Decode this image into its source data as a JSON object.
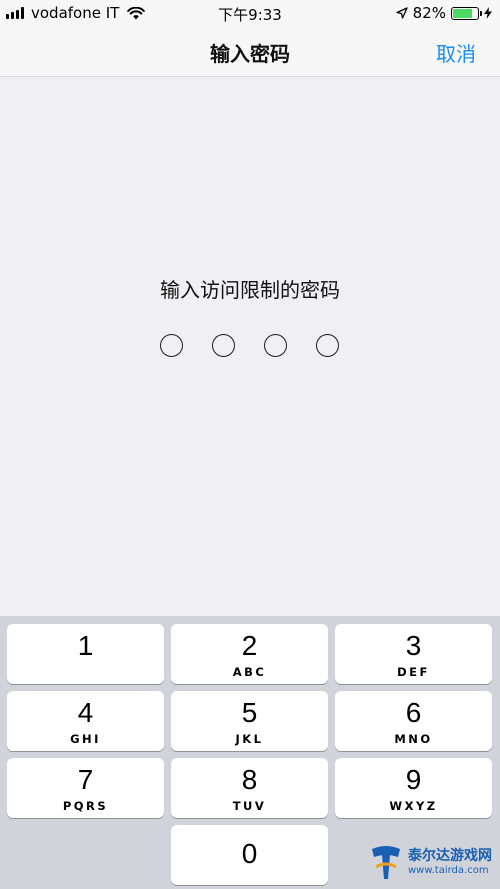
{
  "status_bar": {
    "carrier": "vodafone IT",
    "time": "下午9:33",
    "battery_percent": "82%",
    "battery_level": 0.82,
    "icons": [
      "signal-icon",
      "wifi-icon",
      "location-arrow-icon",
      "battery-icon",
      "charging-bolt-icon"
    ]
  },
  "nav": {
    "title": "输入密码",
    "cancel_label": "取消"
  },
  "prompt": "输入访问限制的密码",
  "passcode": {
    "length": 4,
    "entered": 0
  },
  "keypad": {
    "keys": [
      {
        "digit": "1",
        "letters": ""
      },
      {
        "digit": "2",
        "letters": "ABC"
      },
      {
        "digit": "3",
        "letters": "DEF"
      },
      {
        "digit": "4",
        "letters": "GHI"
      },
      {
        "digit": "5",
        "letters": "JKL"
      },
      {
        "digit": "6",
        "letters": "MNO"
      },
      {
        "digit": "7",
        "letters": "PQRS"
      },
      {
        "digit": "8",
        "letters": "TUV"
      },
      {
        "digit": "9",
        "letters": "WXYZ"
      },
      {
        "digit": "0",
        "letters": ""
      }
    ]
  },
  "watermark": {
    "name": "泰尔达游戏网",
    "url": "www.tairda.com"
  },
  "colors": {
    "accent": "#1a8cf0",
    "battery_fill": "#4cd964",
    "background": "#efeff4",
    "keypad_background": "#d0d3d9"
  }
}
